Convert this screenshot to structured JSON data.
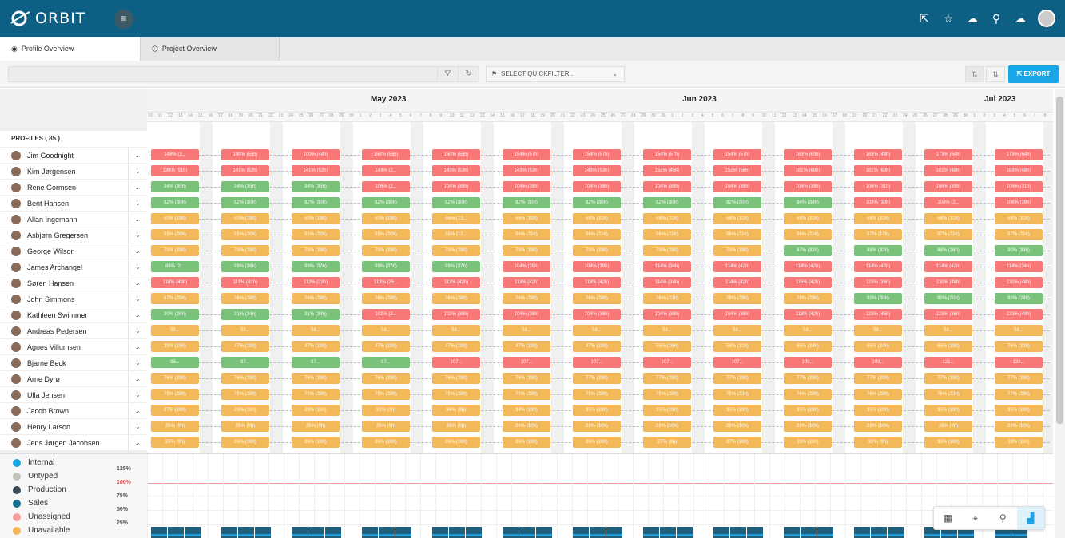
{
  "app": {
    "name": "ORBIT"
  },
  "tabs": [
    {
      "label": "Profile Overview",
      "active": true
    },
    {
      "label": "Project Overview",
      "active": false
    }
  ],
  "toolbar": {
    "quickfilter": "SELECT QUICKFILTER...",
    "export": "EXPORT"
  },
  "timeline": {
    "months": [
      "May 2023",
      "Jun 2023",
      "Jul 2023"
    ],
    "days": [
      "10",
      "11",
      "12",
      "13",
      "14",
      "15",
      "16",
      "17",
      "18",
      "19",
      "20",
      "21",
      "22",
      "23",
      "24",
      "25",
      "26",
      "27",
      "28",
      "29",
      "30",
      "1",
      "2",
      "3",
      "4",
      "5",
      "6",
      "7",
      "8",
      "9",
      "10",
      "11",
      "12",
      "13",
      "14",
      "15",
      "16",
      "17",
      "18",
      "19",
      "20",
      "21",
      "22",
      "23",
      "24",
      "25",
      "26",
      "27",
      "28",
      "29",
      "30",
      "31",
      "1",
      "2",
      "3",
      "4",
      "5",
      "6",
      "7",
      "8",
      "9",
      "10",
      "11",
      "12",
      "13",
      "14",
      "15",
      "16",
      "17",
      "18",
      "19",
      "20",
      "21",
      "22",
      "23",
      "24",
      "25",
      "26",
      "27",
      "28",
      "29",
      "30",
      "1",
      "2",
      "3",
      "4",
      "5",
      "6",
      "7",
      "8"
    ]
  },
  "profiles_header": "PROFILES ( 85 )",
  "profiles": [
    {
      "name": "Jim Goodnight",
      "bars": [
        [
          "148% (3...",
          "red"
        ],
        [
          "149% (55h)",
          "red"
        ],
        [
          "100% (44h)",
          "red"
        ],
        [
          "150% (55h)",
          "red"
        ],
        [
          "150% (55h)",
          "red"
        ],
        [
          "154% (57h)",
          "red"
        ],
        [
          "154% (57h)",
          "red"
        ],
        [
          "154% (57h)",
          "red"
        ],
        [
          "154% (57h)",
          "red"
        ],
        [
          "163% (60h)",
          "red"
        ],
        [
          "163% (48h)",
          "red"
        ],
        [
          "173% (64h)",
          "red"
        ],
        [
          "173% (64h)",
          "red"
        ]
      ]
    },
    {
      "name": "Kim Jørgensen",
      "bars": [
        [
          "139% (51h)",
          "red"
        ],
        [
          "141% (52h)",
          "red"
        ],
        [
          "141% (52h)",
          "red"
        ],
        [
          "143% (2...",
          "red"
        ],
        [
          "143% (53h)",
          "red"
        ],
        [
          "143% (53h)",
          "red"
        ],
        [
          "143% (53h)",
          "red"
        ],
        [
          "152% (45h)",
          "red"
        ],
        [
          "152% (56h)",
          "red"
        ],
        [
          "161% (60h)",
          "red"
        ],
        [
          "161% (60h)",
          "red"
        ],
        [
          "161% (48h)",
          "red"
        ],
        [
          "163% (48h)",
          "red"
        ]
      ]
    },
    {
      "name": "Rene Gormsen",
      "bars": [
        [
          "94% (35h)",
          "green"
        ],
        [
          "94% (35h)",
          "green"
        ],
        [
          "94% (35h)",
          "green"
        ],
        [
          "106% (2...",
          "red"
        ],
        [
          "104% (38h)",
          "red"
        ],
        [
          "104% (38h)",
          "red"
        ],
        [
          "104% (38h)",
          "red"
        ],
        [
          "104% (38h)",
          "red"
        ],
        [
          "104% (38h)",
          "red"
        ],
        [
          "106% (39h)",
          "red"
        ],
        [
          "106% (31h)",
          "red"
        ],
        [
          "106% (39h)",
          "red"
        ],
        [
          "106% (31h)",
          "red"
        ]
      ]
    },
    {
      "name": "Bent Hansen",
      "bars": [
        [
          "82% (30h)",
          "green"
        ],
        [
          "82% (30h)",
          "green"
        ],
        [
          "82% (30h)",
          "green"
        ],
        [
          "82% (30h)",
          "green"
        ],
        [
          "82% (30h)",
          "green"
        ],
        [
          "82% (30h)",
          "green"
        ],
        [
          "82% (30h)",
          "green"
        ],
        [
          "82% (30h)",
          "green"
        ],
        [
          "82% (30h)",
          "green"
        ],
        [
          "94% (34h)",
          "green"
        ],
        [
          "103% (30h)",
          "red"
        ],
        [
          "104% (2...",
          "red"
        ],
        [
          "106% (39h)",
          "red"
        ]
      ]
    },
    {
      "name": "Allan Ingemann",
      "bars": [
        [
          "50% (19h)",
          "orange"
        ],
        [
          "50% (19h)",
          "orange"
        ],
        [
          "50% (19h)",
          "orange"
        ],
        [
          "50% (19h)",
          "orange"
        ],
        [
          "55% (13...",
          "orange"
        ],
        [
          "55% (20h)",
          "orange"
        ],
        [
          "58% (21h)",
          "orange"
        ],
        [
          "58% (21h)",
          "orange"
        ],
        [
          "58% (21h)",
          "orange"
        ],
        [
          "58% (21h)",
          "orange"
        ],
        [
          "58% (21h)",
          "orange"
        ],
        [
          "58% (21h)",
          "orange"
        ],
        [
          "58% (21h)",
          "orange"
        ]
      ]
    },
    {
      "name": "Asbjørn Gregersen",
      "bars": [
        [
          "55% (20h)",
          "orange"
        ],
        [
          "55% (20h)",
          "orange"
        ],
        [
          "55% (20h)",
          "orange"
        ],
        [
          "55% (20h)",
          "orange"
        ],
        [
          "55% (12...",
          "orange"
        ],
        [
          "56% (21h)",
          "orange"
        ],
        [
          "56% (21h)",
          "orange"
        ],
        [
          "56% (21h)",
          "orange"
        ],
        [
          "56% (21h)",
          "orange"
        ],
        [
          "56% (21h)",
          "orange"
        ],
        [
          "57% (17h)",
          "orange"
        ],
        [
          "57% (21h)",
          "orange"
        ],
        [
          "57% (21h)",
          "orange"
        ]
      ]
    },
    {
      "name": "George Wilson",
      "bars": [
        [
          "79% (29h)",
          "orange"
        ],
        [
          "79% (29h)",
          "orange"
        ],
        [
          "79% (29h)",
          "orange"
        ],
        [
          "79% (29h)",
          "orange"
        ],
        [
          "79% (29h)",
          "orange"
        ],
        [
          "79% (29h)",
          "orange"
        ],
        [
          "79% (29h)",
          "orange"
        ],
        [
          "79% (29h)",
          "orange"
        ],
        [
          "79% (29h)",
          "orange"
        ],
        [
          "87% (32h)",
          "green"
        ],
        [
          "88% (33h)",
          "green"
        ],
        [
          "88% (26h)",
          "green"
        ],
        [
          "90% (33h)",
          "green"
        ]
      ]
    },
    {
      "name": "James Archangel",
      "bars": [
        [
          "88% (2...",
          "green"
        ],
        [
          "99% (36h)",
          "green"
        ],
        [
          "99% (37h)",
          "green"
        ],
        [
          "99% (37h)",
          "green"
        ],
        [
          "99% (37h)",
          "green"
        ],
        [
          "104% (39h)",
          "red"
        ],
        [
          "104% (39h)",
          "red"
        ],
        [
          "114% (34h)",
          "red"
        ],
        [
          "114% (42h)",
          "red"
        ],
        [
          "114% (42h)",
          "red"
        ],
        [
          "114% (42h)",
          "red"
        ],
        [
          "114% (42h)",
          "red"
        ],
        [
          "114% (34h)",
          "red"
        ]
      ]
    },
    {
      "name": "Søren Hansen",
      "bars": [
        [
          "110% (40h)",
          "red"
        ],
        [
          "111% (41h)",
          "red"
        ],
        [
          "112% (33h)",
          "red"
        ],
        [
          "113% (25...",
          "red"
        ],
        [
          "113% (42h)",
          "red"
        ],
        [
          "113% (42h)",
          "red"
        ],
        [
          "113% (42h)",
          "red"
        ],
        [
          "114% (34h)",
          "red"
        ],
        [
          "114% (42h)",
          "red"
        ],
        [
          "115% (42h)",
          "red"
        ],
        [
          "123% (36h)",
          "red"
        ],
        [
          "130% (48h)",
          "red"
        ],
        [
          "130% (48h)",
          "red"
        ]
      ]
    },
    {
      "name": "John Simmons",
      "bars": [
        [
          "67% (25h)",
          "orange"
        ],
        [
          "76% (28h)",
          "orange"
        ],
        [
          "76% (28h)",
          "orange"
        ],
        [
          "76% (28h)",
          "orange"
        ],
        [
          "76% (28h)",
          "orange"
        ],
        [
          "76% (28h)",
          "orange"
        ],
        [
          "76% (28h)",
          "orange"
        ],
        [
          "76% (23h)",
          "orange"
        ],
        [
          "78% (29h)",
          "orange"
        ],
        [
          "78% (29h)",
          "orange"
        ],
        [
          "80% (30h)",
          "green"
        ],
        [
          "80% (30h)",
          "green"
        ],
        [
          "80% (24h)",
          "green"
        ]
      ]
    },
    {
      "name": "Kathleen Swimmer",
      "bars": [
        [
          "90% (26h)",
          "green"
        ],
        [
          "91% (34h)",
          "green"
        ],
        [
          "91% (34h)",
          "green"
        ],
        [
          "102% (2...",
          "red"
        ],
        [
          "102% (38h)",
          "red"
        ],
        [
          "104% (38h)",
          "red"
        ],
        [
          "104% (38h)",
          "red"
        ],
        [
          "104% (38h)",
          "red"
        ],
        [
          "104% (38h)",
          "red"
        ],
        [
          "113% (42h)",
          "red"
        ],
        [
          "123% (45h)",
          "red"
        ],
        [
          "123% (36h)",
          "red"
        ],
        [
          "133% (49h)",
          "red"
        ]
      ]
    },
    {
      "name": "Andreas Pedersen",
      "bars": [
        [
          "55...",
          "orange"
        ],
        [
          "55...",
          "orange"
        ],
        [
          "56...",
          "orange"
        ],
        [
          "56...",
          "orange"
        ],
        [
          "56...",
          "orange"
        ],
        [
          "56...",
          "orange"
        ],
        [
          "56...",
          "orange"
        ],
        [
          "56...",
          "orange"
        ],
        [
          "56...",
          "orange"
        ],
        [
          "56...",
          "orange"
        ],
        [
          "56...",
          "orange"
        ],
        [
          "56...",
          "orange"
        ],
        [
          "56...",
          "orange"
        ]
      ]
    },
    {
      "name": "Agnes Villumsen",
      "bars": [
        [
          "39% (15h)",
          "orange"
        ],
        [
          "47% (18h)",
          "orange"
        ],
        [
          "47% (18h)",
          "orange"
        ],
        [
          "47% (18h)",
          "orange"
        ],
        [
          "47% (18h)",
          "orange"
        ],
        [
          "47% (18h)",
          "orange"
        ],
        [
          "47% (18h)",
          "orange"
        ],
        [
          "55% (16h)",
          "orange"
        ],
        [
          "58% (21h)",
          "orange"
        ],
        [
          "65% (24h)",
          "orange"
        ],
        [
          "65% (24h)",
          "orange"
        ],
        [
          "65% (19h)",
          "orange"
        ],
        [
          "76% (23h)",
          "orange"
        ]
      ]
    },
    {
      "name": "Bjarne Beck",
      "bars": [
        [
          "95...",
          "green"
        ],
        [
          "97...",
          "green"
        ],
        [
          "97...",
          "green"
        ],
        [
          "97...",
          "green"
        ],
        [
          "107...",
          "red"
        ],
        [
          "107...",
          "red"
        ],
        [
          "107...",
          "red"
        ],
        [
          "107...",
          "red"
        ],
        [
          "107...",
          "red"
        ],
        [
          "109...",
          "red"
        ],
        [
          "109...",
          "red"
        ],
        [
          "121...",
          "red"
        ],
        [
          "132...",
          "red"
        ]
      ]
    },
    {
      "name": "Arne Dyrø",
      "bars": [
        [
          "76% (29h)",
          "orange"
        ],
        [
          "76% (29h)",
          "orange"
        ],
        [
          "76% (29h)",
          "orange"
        ],
        [
          "76% (29h)",
          "orange"
        ],
        [
          "76% (29h)",
          "orange"
        ],
        [
          "76% (29h)",
          "orange"
        ],
        [
          "77% (29h)",
          "orange"
        ],
        [
          "77% (29h)",
          "orange"
        ],
        [
          "77% (29h)",
          "orange"
        ],
        [
          "77% (29h)",
          "orange"
        ],
        [
          "77% (20h)",
          "orange"
        ],
        [
          "77% (29h)",
          "orange"
        ],
        [
          "77% (29h)",
          "orange"
        ]
      ]
    },
    {
      "name": "Ulla Jensen",
      "bars": [
        [
          "75% (28h)",
          "orange"
        ],
        [
          "75% (28h)",
          "orange"
        ],
        [
          "75% (28h)",
          "orange"
        ],
        [
          "75% (28h)",
          "orange"
        ],
        [
          "75% (28h)",
          "orange"
        ],
        [
          "75% (28h)",
          "orange"
        ],
        [
          "75% (28h)",
          "orange"
        ],
        [
          "75% (28h)",
          "orange"
        ],
        [
          "75% (23h)",
          "orange"
        ],
        [
          "76% (28h)",
          "orange"
        ],
        [
          "76% (28h)",
          "orange"
        ],
        [
          "76% (23h)",
          "orange"
        ],
        [
          "77% (29h)",
          "orange"
        ]
      ]
    },
    {
      "name": "Jacob Brown",
      "bars": [
        [
          "27% (10h)",
          "orange"
        ],
        [
          "29% (11h)",
          "orange"
        ],
        [
          "29% (11h)",
          "orange"
        ],
        [
          "31% (7h)",
          "orange"
        ],
        [
          "34% (8h)",
          "orange"
        ],
        [
          "34% (13h)",
          "orange"
        ],
        [
          "35% (13h)",
          "orange"
        ],
        [
          "35% (13h)",
          "orange"
        ],
        [
          "35% (13h)",
          "orange"
        ],
        [
          "35% (13h)",
          "orange"
        ],
        [
          "35% (13h)",
          "orange"
        ],
        [
          "35% (13h)",
          "orange"
        ],
        [
          "35% (10h)",
          "orange"
        ]
      ]
    },
    {
      "name": "Henry Larson",
      "bars": [
        [
          "25% (9h)",
          "orange"
        ],
        [
          "25% (9h)",
          "orange"
        ],
        [
          "25% (9h)",
          "orange"
        ],
        [
          "25% (9h)",
          "orange"
        ],
        [
          "28% (6h)",
          "orange"
        ],
        [
          "26% (10h)",
          "orange"
        ],
        [
          "28% (10h)",
          "orange"
        ],
        [
          "28% (10h)",
          "orange"
        ],
        [
          "28% (10h)",
          "orange"
        ],
        [
          "28% (10h)",
          "orange"
        ],
        [
          "28% (10h)",
          "orange"
        ],
        [
          "28% (8h)",
          "orange"
        ],
        [
          "28% (10h)",
          "orange"
        ]
      ]
    },
    {
      "name": "Jens Jørgen Jacobsen",
      "bars": [
        [
          "25% (9h)",
          "orange"
        ],
        [
          "26% (10h)",
          "orange"
        ],
        [
          "26% (10h)",
          "orange"
        ],
        [
          "26% (10h)",
          "orange"
        ],
        [
          "26% (10h)",
          "orange"
        ],
        [
          "26% (10h)",
          "orange"
        ],
        [
          "26% (10h)",
          "orange"
        ],
        [
          "27% (8h)",
          "orange"
        ],
        [
          "27% (10h)",
          "orange"
        ],
        [
          "31% (11h)",
          "orange"
        ],
        [
          "32% (9h)",
          "orange"
        ],
        [
          "33% (10h)",
          "orange"
        ],
        [
          "33% (11h)",
          "orange"
        ]
      ]
    }
  ],
  "legend": [
    {
      "label": "Internal",
      "color": "#1ba6e8"
    },
    {
      "label": "Untyped",
      "color": "#c3c3bb"
    },
    {
      "label": "Production",
      "color": "#3b4a55"
    },
    {
      "label": "Sales",
      "color": "#17708f"
    },
    {
      "label": "Unassigned",
      "color": "#f7a0a0"
    },
    {
      "label": "Unavailable",
      "color": "#f2b85a"
    }
  ],
  "chart_axis": [
    "125%",
    "100%",
    "75%",
    "50%",
    "25%"
  ],
  "colors": {
    "red": "#f87777",
    "green": "#79c27a",
    "orange": "#f2b85a",
    "topbar": "#0e5f84",
    "export": "#1ba6e8"
  }
}
